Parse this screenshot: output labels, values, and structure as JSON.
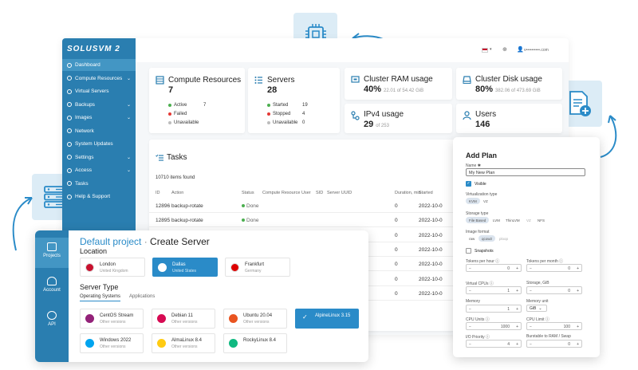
{
  "brand": "SOLUSVM 2",
  "topbar": {
    "user": "v••••••••••.com"
  },
  "sidebar": {
    "items": [
      {
        "label": "Dashboard",
        "active": true,
        "chev": false
      },
      {
        "label": "Compute Resources",
        "chev": true
      },
      {
        "label": "Virtual Servers",
        "chev": false
      },
      {
        "label": "Backups",
        "chev": true
      },
      {
        "label": "Images",
        "chev": true
      },
      {
        "label": "Network",
        "chev": false
      },
      {
        "label": "System Updates",
        "chev": false
      },
      {
        "label": "Settings",
        "chev": true
      },
      {
        "label": "Access",
        "chev": true
      },
      {
        "label": "Tasks",
        "chev": false
      },
      {
        "label": "Help & Support",
        "chev": false
      }
    ]
  },
  "cards": {
    "compute": {
      "title": "Compute Resources",
      "count": "7",
      "items": [
        {
          "label": "Active",
          "value": "7",
          "color": "#4caf50"
        },
        {
          "label": "Failed",
          "value": "",
          "color": "#e53935"
        },
        {
          "label": "Unavailable",
          "value": "",
          "color": "#bdbdbd"
        }
      ]
    },
    "servers": {
      "title": "Servers",
      "count": "28",
      "items": [
        {
          "label": "Started",
          "value": "19",
          "color": "#4caf50"
        },
        {
          "label": "Stopped",
          "value": "4",
          "color": "#e53935"
        },
        {
          "label": "Unavailable",
          "value": "0",
          "color": "#bdbdbd"
        }
      ]
    },
    "ram": {
      "title": "Cluster RAM usage",
      "pct": "40%",
      "sub": "22.01 of 54.42 GiB"
    },
    "disk": {
      "title": "Cluster Disk usage",
      "pct": "80%",
      "sub": "382.06 of 473.69 GiB"
    },
    "ipv4": {
      "title": "IPv4 usage",
      "value": "29",
      "sub": "of 253"
    },
    "users": {
      "title": "Users",
      "value": "146"
    }
  },
  "tasks": {
    "title": "Tasks",
    "found": "10710 items found",
    "columns": [
      "ID",
      "Action",
      "Status",
      "Compute Resource",
      "User",
      "SID",
      "Server UUID",
      "Duration, min",
      "Started"
    ],
    "rows": [
      {
        "id": "12896",
        "action": "backup-rotate",
        "status": "Done",
        "duration": "0",
        "started": "2022-10-0"
      },
      {
        "id": "12895",
        "action": "backup-rotate",
        "status": "Done",
        "duration": "0",
        "started": "2022-10-0"
      },
      {
        "id": "",
        "action": "",
        "status": "",
        "duration": "0",
        "started": "2022-10-0"
      },
      {
        "id": "",
        "action": "",
        "status": "",
        "duration": "0",
        "started": "2022-10-0"
      },
      {
        "id": "",
        "action": "",
        "status": "",
        "duration": "0",
        "started": "2022-10-0"
      },
      {
        "id": "",
        "action": "",
        "status": "",
        "duration": "0",
        "started": "2022-10-0"
      },
      {
        "id": "",
        "action": "",
        "status": "",
        "duration": "0",
        "started": "2022-10-0"
      }
    ]
  },
  "create_server": {
    "project": "Default project",
    "sep": " · ",
    "title": "Create Server",
    "nav": [
      {
        "label": "Projects"
      },
      {
        "label": "Account"
      },
      {
        "label": "API"
      }
    ],
    "location_title": "Location",
    "locations": [
      {
        "name": "London",
        "sub": "United Kingdom",
        "color": "#c8102e",
        "selected": false
      },
      {
        "name": "Dallas",
        "sub": "United States",
        "color": "#ffffff",
        "selected": true
      },
      {
        "name": "Frankfurt",
        "sub": "Germany",
        "color": "#dd0000",
        "selected": false
      }
    ],
    "server_type_title": "Server Type",
    "tabs": [
      "Operating Systems",
      "Applications"
    ],
    "os": [
      {
        "name": "CentOS Stream",
        "sub": "Other versions",
        "color": "#932279"
      },
      {
        "name": "Debian 11",
        "sub": "Other versions",
        "color": "#d70a53"
      },
      {
        "name": "Ubuntu 20.04",
        "sub": "Other versions",
        "color": "#e95420"
      },
      {
        "name": "AlpineLinux 3.15",
        "sub": "",
        "color": "#ffffff"
      },
      {
        "name": "Windows 2022",
        "sub": "Other versions",
        "color": "#00a4ef"
      },
      {
        "name": "AlmaLinux 8.4",
        "sub": "Other versions",
        "color": "#ffcb12"
      },
      {
        "name": "RockyLinux 8.4",
        "sub": "",
        "color": "#10b981"
      }
    ]
  },
  "add_plan": {
    "title": "Add Plan",
    "name_label": "Name ✱",
    "name_value": "My New Plan",
    "visible": "Visible",
    "virt_label": "Virtualization type",
    "virt": [
      "KVM",
      "VZ"
    ],
    "storage_label": "Storage type",
    "storage": [
      "File Based",
      "LVM",
      "ThinLVM",
      "VZ",
      "NFS"
    ],
    "format_label": "Image format",
    "format": [
      "raw",
      "qcow2",
      "ploop"
    ],
    "snapshots": "Snapshots",
    "tokens_hour": "Tokens per hour ⓘ",
    "tokens_month": "Tokens per month ⓘ",
    "vcpu": "Virtual CPUs ⓘ",
    "storage_gib": "Storage, GiB",
    "memory": "Memory",
    "memory_unit": "Memory unit",
    "memory_unit_val": "GiB",
    "cpu_units": "CPU Units ⓘ",
    "cpu_limit": "CPU Limit ⓘ",
    "io_priority": "I/O Priority ⓘ",
    "swap": "Burstable to RAM / Swap",
    "v_tokens_hour": "0",
    "v_tokens_month": "0",
    "v_vcpu": "1",
    "v_storage": "0",
    "v_memory": "1",
    "v_cpu_units": "1000",
    "v_cpu_limit": "100",
    "v_io": "4",
    "v_swap": "0"
  }
}
